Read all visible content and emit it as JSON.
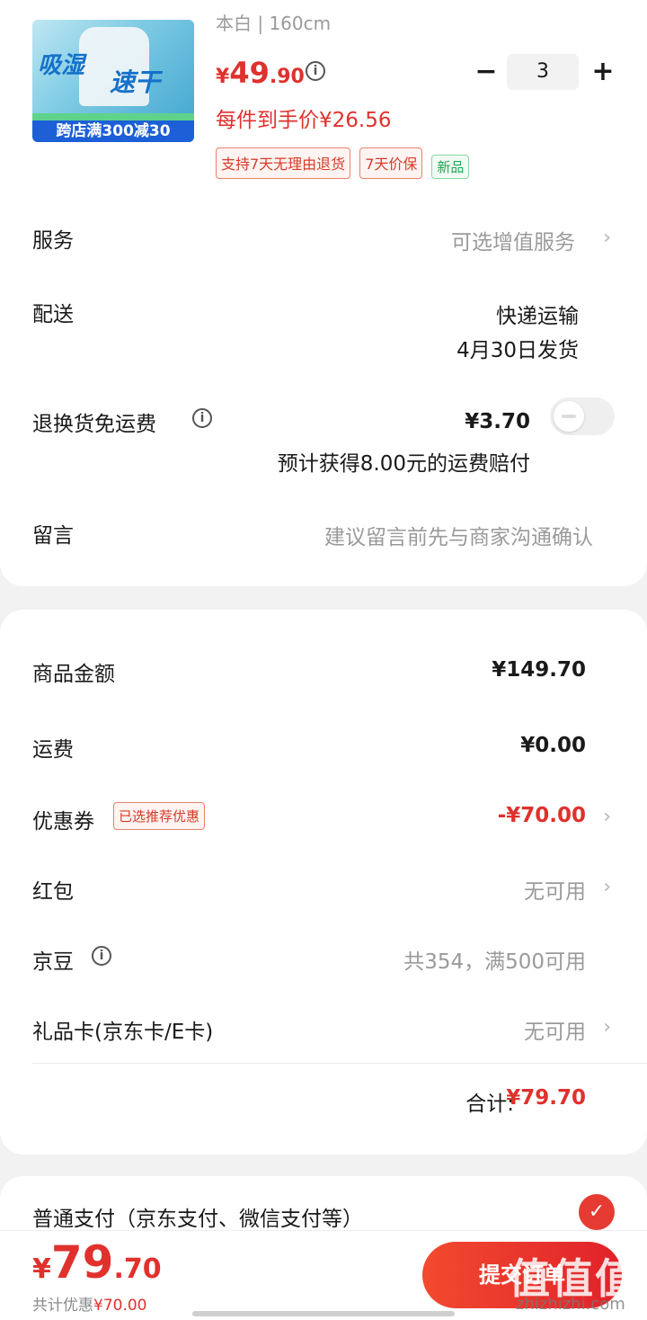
{
  "product": {
    "thumb_text1": "吸湿",
    "thumb_text2": "速干",
    "thumb_banner": "跨店满300减30",
    "spec": "本白 | 160cm",
    "price_currency": "¥",
    "price_int": "49",
    "price_dec": ".90",
    "per_item_price": "每件到手价¥26.56",
    "tags": [
      "支持7天无理由退货",
      "7天价保",
      "新品"
    ],
    "quantity": "3",
    "minus": "−",
    "plus": "+"
  },
  "rows": {
    "service": {
      "label": "服务",
      "value": "可选增值服务"
    },
    "delivery": {
      "label": "配送",
      "value1": "快递运输",
      "value2": "4月30日发货"
    },
    "return": {
      "label": "退换货免运费",
      "value": "¥3.70",
      "note": "预计获得8.00元的运费赔付",
      "enabled": false
    },
    "message": {
      "label": "留言",
      "placeholder": "建议留言前先与商家沟通确认"
    }
  },
  "summary": {
    "goods": {
      "label": "商品金额",
      "value": "¥149.70"
    },
    "shipping": {
      "label": "运费",
      "value": "¥0.00"
    },
    "coupon": {
      "label": "优惠券",
      "tag": "已选推荐优惠",
      "value": "-¥70.00"
    },
    "redpacket": {
      "label": "红包",
      "value": "无可用"
    },
    "jingdou": {
      "label": "京豆",
      "value": "共354，满500可用"
    },
    "giftcard": {
      "label": "礼品卡(京东卡/E卡)",
      "value": "无可用"
    },
    "total_label": "合计:",
    "total_value": "¥79.70"
  },
  "payment": {
    "label": "普通支付（京东支付、微信支付等）",
    "selected": true
  },
  "bottom": {
    "currency": "¥",
    "int": "79",
    "dec": ".70",
    "saved_label": "共计优惠",
    "saved_value": "¥70.00",
    "submit": "提交订单"
  },
  "watermark": {
    "main": "值值值",
    "sub": "zhizhizhi.com"
  },
  "colors": {
    "accent": "#e0312d",
    "green_tag": "#21a352"
  }
}
